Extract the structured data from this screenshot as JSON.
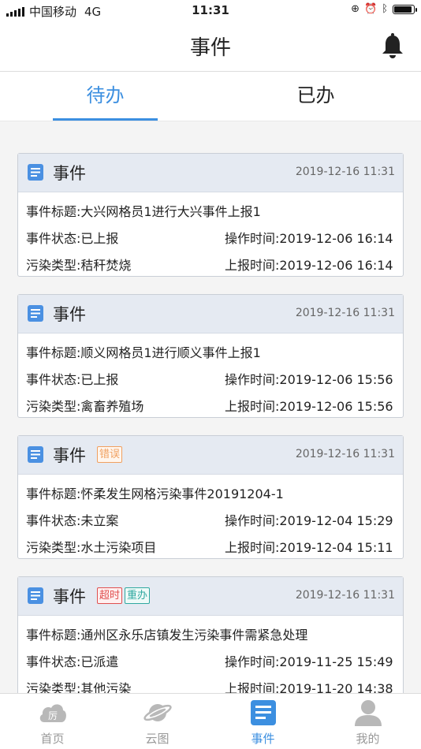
{
  "status_bar": {
    "carrier": "中国移动",
    "network": "4G",
    "time": "11:31"
  },
  "nav": {
    "title": "事件",
    "bell_icon": "bell-icon"
  },
  "tabs": [
    {
      "label": "待办",
      "active": true
    },
    {
      "label": "已办",
      "active": false
    }
  ],
  "cards": [
    {
      "title": "事件",
      "time": "2019-12-16 11:31",
      "tags": [],
      "event_title_label": "事件标题:",
      "event_title": "大兴网格员1进行大兴事件上报1",
      "status_label": "事件状态:",
      "status": "已上报",
      "op_time_label": "操作时间:",
      "op_time": "2019-12-06 16:14",
      "pollution_label": "污染类型:",
      "pollution": "秸秆焚烧",
      "report_time_label": "上报时间:",
      "report_time": "2019-12-06 16:14"
    },
    {
      "title": "事件",
      "time": "2019-12-16 11:31",
      "tags": [],
      "event_title_label": "事件标题:",
      "event_title": "顺义网格员1进行顺义事件上报1",
      "status_label": "事件状态:",
      "status": "已上报",
      "op_time_label": "操作时间:",
      "op_time": "2019-12-06 15:56",
      "pollution_label": "污染类型:",
      "pollution": "禽畜养殖场",
      "report_time_label": "上报时间:",
      "report_time": "2019-12-06 15:56"
    },
    {
      "title": "事件",
      "time": "2019-12-16 11:31",
      "tags": [
        {
          "text": "错误",
          "color": "#f0a060"
        }
      ],
      "event_title_label": "事件标题:",
      "event_title": "怀柔发生网格污染事件20191204-1",
      "status_label": "事件状态:",
      "status": "未立案",
      "op_time_label": "操作时间:",
      "op_time": "2019-12-04 15:29",
      "pollution_label": "污染类型:",
      "pollution": "水土污染项目",
      "report_time_label": "上报时间:",
      "report_time": "2019-12-04 15:11"
    },
    {
      "title": "事件",
      "time": "2019-12-16 11:31",
      "tags": [
        {
          "text": "超时",
          "color": "#e05050"
        },
        {
          "text": "重办",
          "color": "#30a8a0"
        }
      ],
      "event_title_label": "事件标题:",
      "event_title": "通州区永乐店镇发生污染事件需紧急处理",
      "status_label": "事件状态:",
      "status": "已派遣",
      "op_time_label": "操作时间:",
      "op_time": "2019-11-25 15:49",
      "pollution_label": "污染类型:",
      "pollution": "其他污染",
      "report_time_label": "上报时间:",
      "report_time": "2019-11-20 14:38"
    }
  ],
  "tabbar": [
    {
      "label": "首页",
      "icon": "home-cloud-icon",
      "active": false
    },
    {
      "label": "云图",
      "icon": "planet-icon",
      "active": false
    },
    {
      "label": "事件",
      "icon": "event-list-icon",
      "active": true
    },
    {
      "label": "我的",
      "icon": "user-icon",
      "active": false
    }
  ],
  "colors": {
    "accent": "#3c8fe0",
    "card_header": "#e5eaf2",
    "inactive": "#999999"
  }
}
